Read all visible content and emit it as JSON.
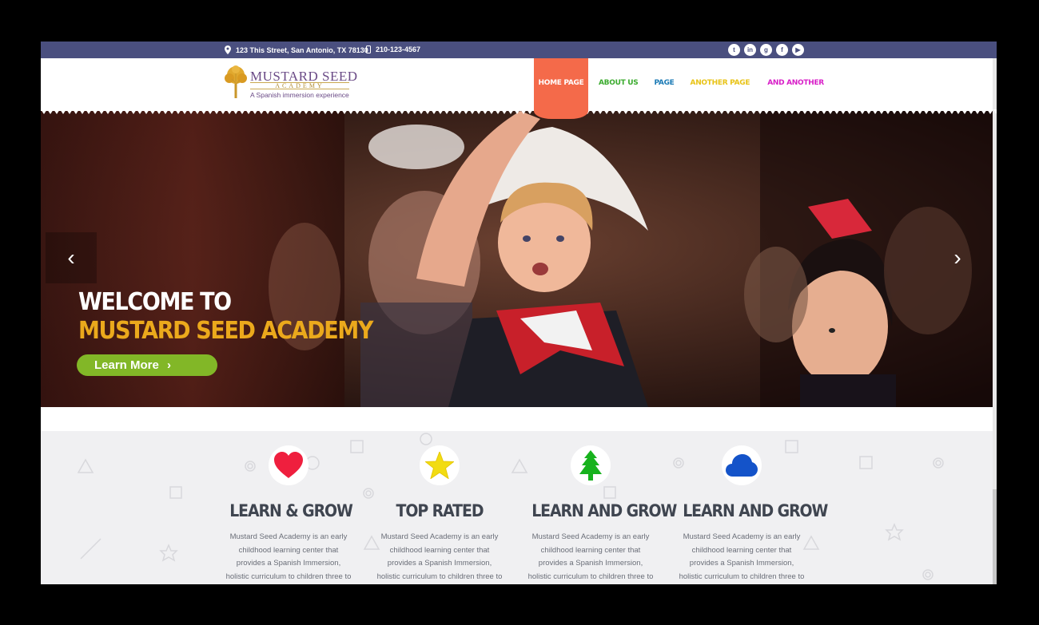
{
  "topbar": {
    "address": "123 This Street, San Antonio, TX 78130",
    "phone": "210-123-4567",
    "social": [
      {
        "icon": "twitter-icon",
        "glyph": "t"
      },
      {
        "icon": "linkedin-icon",
        "glyph": "in"
      },
      {
        "icon": "google-plus-icon",
        "glyph": "g"
      },
      {
        "icon": "facebook-icon",
        "glyph": "f"
      },
      {
        "icon": "youtube-icon",
        "glyph": "▶"
      }
    ]
  },
  "logo": {
    "name": "MUSTARD SEED",
    "sub": "ACADEMY",
    "tagline": "A Spanish immersion experience"
  },
  "nav": [
    {
      "label": "HOME PAGE",
      "color": "#ffffff"
    },
    {
      "label": "ABOUT US",
      "color": "#3bab2e"
    },
    {
      "label": "PAGE",
      "color": "#1a7ab5"
    },
    {
      "label": "ANOTHER PAGE",
      "color": "#e8c316"
    },
    {
      "label": "AND ANOTHER",
      "color": "#d81ec8"
    }
  ],
  "hero": {
    "line1": "WELCOME TO",
    "line2": "MUSTARD SEED ACADEMY",
    "button": "Learn More",
    "button_arrow": "›",
    "prev": "‹",
    "next": "›"
  },
  "features": [
    {
      "icon": "heart-icon",
      "color": "#ef1f3e",
      "title": "LEARN & GROW",
      "text": "Mustard Seed Academy is an early childhood learning center that provides a Spanish Immersion, holistic curriculum to children three to five"
    },
    {
      "icon": "star-icon",
      "color": "#f2dc12",
      "title": "TOP RATED",
      "text": "Mustard Seed Academy is an early childhood learning center that provides a Spanish Immersion, holistic curriculum to children three to five"
    },
    {
      "icon": "tree-icon",
      "color": "#17b21d",
      "title": "LEARN AND GROW",
      "text": "Mustard Seed Academy is an early childhood learning center that provides a Spanish Immersion, holistic curriculum to children three to five"
    },
    {
      "icon": "cloud-icon",
      "color": "#1453c9",
      "title": "LEARN AND GROW",
      "text": "Mustard Seed Academy is an early childhood learning center that provides a Spanish Immersion, holistic curriculum to children three to five"
    }
  ],
  "colors": {
    "topbar": "#4a4f7f",
    "active_nav": "#f46a4a",
    "hero_accent": "#eba91c",
    "button": "#82b727"
  }
}
